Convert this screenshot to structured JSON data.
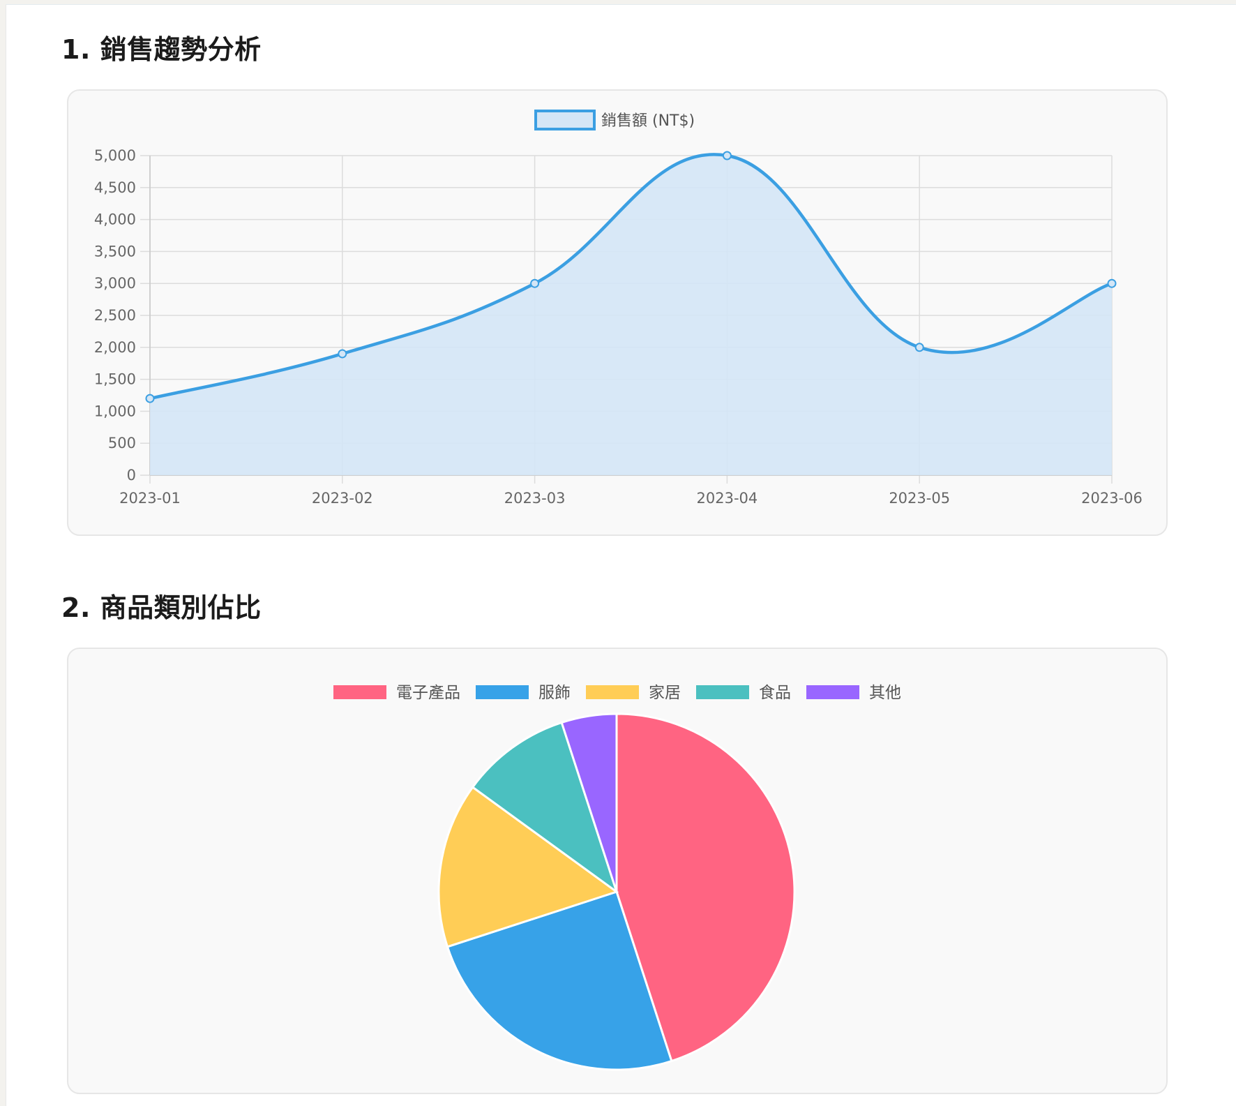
{
  "sections": [
    {
      "number": "1.",
      "title": "銷售趨勢分析"
    },
    {
      "number": "2.",
      "title": "商品類別佔比"
    }
  ],
  "colors": {
    "line": "#3b9fe2",
    "area_fill": "#d4e6f6",
    "pie": [
      "#ff6482",
      "#37a2e8",
      "#ffcd56",
      "#4bc0c0",
      "#9966ff"
    ]
  },
  "chart_data": [
    {
      "type": "area",
      "title": "",
      "xlabel": "",
      "ylabel": "",
      "categories": [
        "2023-01",
        "2023-02",
        "2023-03",
        "2023-04",
        "2023-05",
        "2023-06"
      ],
      "series": [
        {
          "name": "銷售額 (NT$)",
          "values": [
            1200,
            1900,
            3000,
            5000,
            2000,
            3000
          ]
        }
      ],
      "ylim": [
        0,
        5000
      ],
      "yticks": [
        "0",
        "500",
        "1,000",
        "1,500",
        "2,000",
        "2,500",
        "3,000",
        "3,500",
        "4,000",
        "4,500",
        "5,000"
      ],
      "grid": true,
      "legend": "top-center"
    },
    {
      "type": "pie",
      "title": "",
      "categories": [
        "電子產品",
        "服飾",
        "家居",
        "食品",
        "其他"
      ],
      "values": [
        45,
        25,
        15,
        10,
        5
      ],
      "legend": "top-center"
    }
  ]
}
